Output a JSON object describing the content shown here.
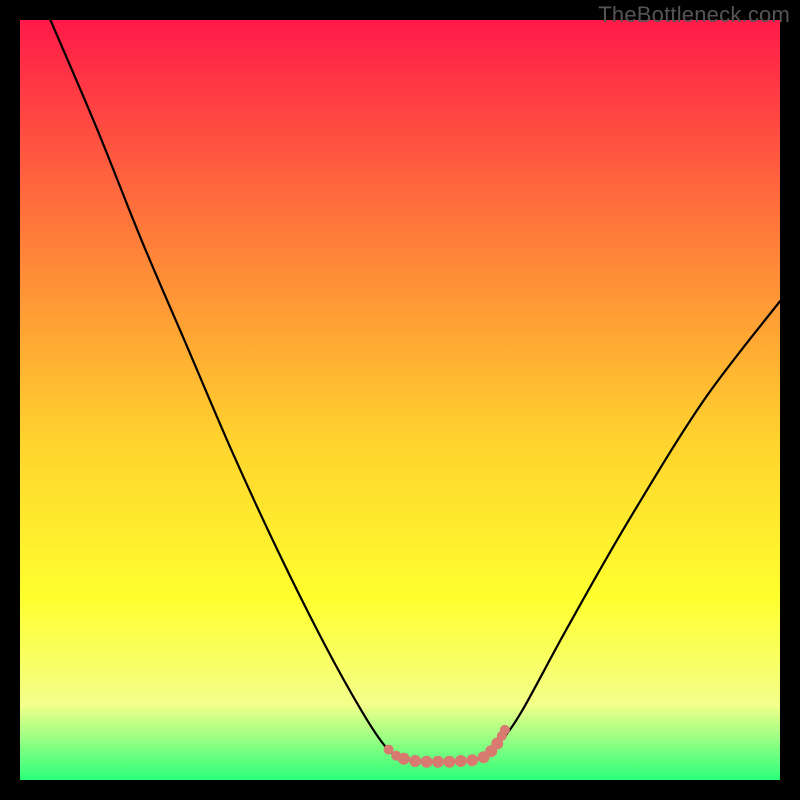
{
  "watermark": "TheBottleneck.com",
  "chart_data": {
    "type": "line",
    "title": "",
    "xlabel": "",
    "ylabel": "",
    "xlim": [
      0,
      100
    ],
    "ylim": [
      0,
      100
    ],
    "background_gradient": {
      "top": "#ff1a49",
      "mid_upper": "#ff7b3a",
      "mid": "#ffd22e",
      "mid_lower": "#ffff2e",
      "lower": "#f4ff8a",
      "bottom": "#2bff7a"
    },
    "series": [
      {
        "name": "bottleneck-curve",
        "type": "curve",
        "points": [
          {
            "x": 4,
            "y": 100
          },
          {
            "x": 10,
            "y": 86
          },
          {
            "x": 16,
            "y": 71
          },
          {
            "x": 22,
            "y": 57
          },
          {
            "x": 28,
            "y": 43
          },
          {
            "x": 34,
            "y": 30
          },
          {
            "x": 40,
            "y": 18
          },
          {
            "x": 45,
            "y": 9
          },
          {
            "x": 48,
            "y": 4.5
          },
          {
            "x": 50,
            "y": 3.0
          },
          {
            "x": 53,
            "y": 2.4
          },
          {
            "x": 56,
            "y": 2.4
          },
          {
            "x": 59,
            "y": 2.6
          },
          {
            "x": 61,
            "y": 3.0
          },
          {
            "x": 63,
            "y": 4.8
          },
          {
            "x": 66,
            "y": 9
          },
          {
            "x": 72,
            "y": 20
          },
          {
            "x": 80,
            "y": 34
          },
          {
            "x": 90,
            "y": 50
          },
          {
            "x": 100,
            "y": 63
          }
        ]
      },
      {
        "name": "bottom-markers",
        "type": "markers",
        "color": "#d87a6f",
        "points": [
          {
            "x": 48.5,
            "y": 4.0,
            "r": 5
          },
          {
            "x": 49.5,
            "y": 3.2,
            "r": 5
          },
          {
            "x": 50.5,
            "y": 2.8,
            "r": 6
          },
          {
            "x": 52.0,
            "y": 2.5,
            "r": 6
          },
          {
            "x": 53.5,
            "y": 2.4,
            "r": 6
          },
          {
            "x": 55.0,
            "y": 2.4,
            "r": 6
          },
          {
            "x": 56.5,
            "y": 2.4,
            "r": 6
          },
          {
            "x": 58.0,
            "y": 2.5,
            "r": 6
          },
          {
            "x": 59.5,
            "y": 2.6,
            "r": 6
          },
          {
            "x": 61.0,
            "y": 3.0,
            "r": 6
          },
          {
            "x": 62.0,
            "y": 3.8,
            "r": 6
          },
          {
            "x": 62.8,
            "y": 4.8,
            "r": 6
          },
          {
            "x": 63.4,
            "y": 5.8,
            "r": 5
          },
          {
            "x": 63.8,
            "y": 6.6,
            "r": 5
          }
        ]
      }
    ]
  }
}
